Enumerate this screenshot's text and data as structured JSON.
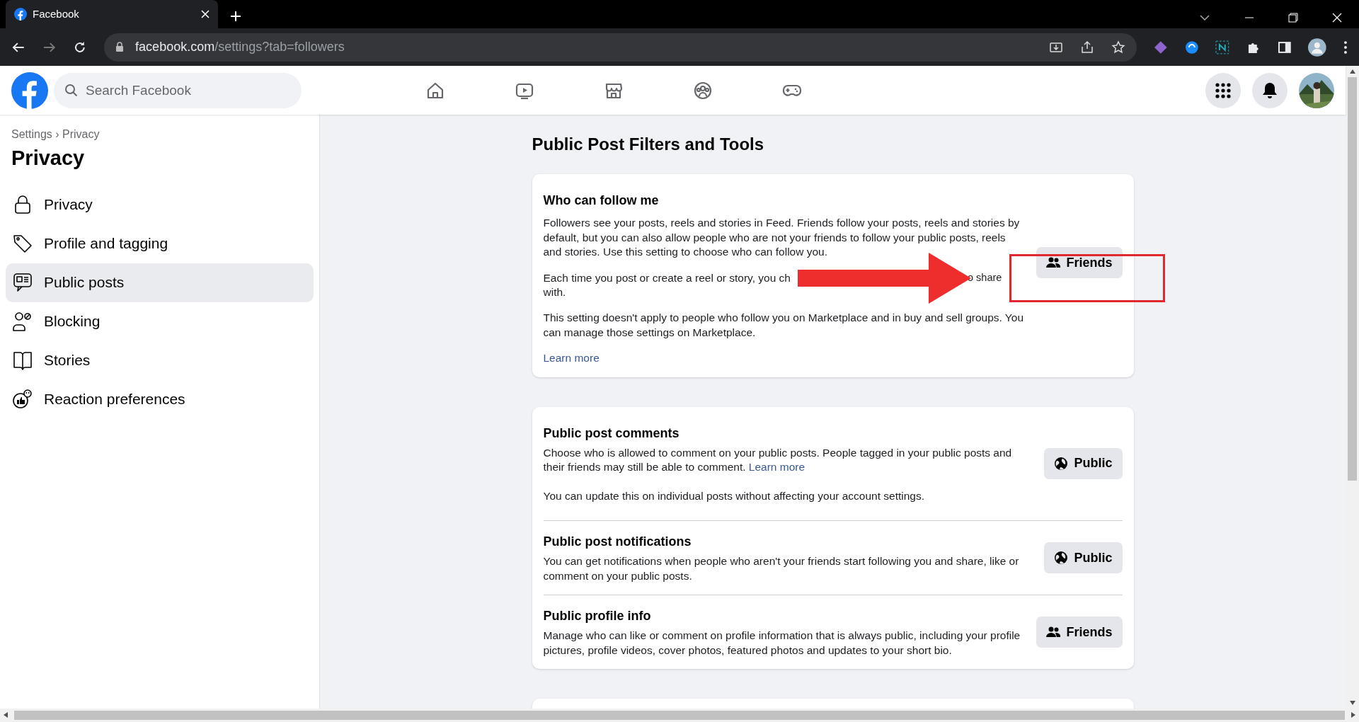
{
  "browser": {
    "tab_title": "Facebook",
    "url_host": "facebook.com",
    "url_path": "/settings?tab=followers"
  },
  "header": {
    "search": {
      "placeholder": "Search Facebook"
    },
    "nav": [
      {
        "selected": false
      },
      {
        "selected": false
      },
      {
        "selected": false
      },
      {
        "selected": false
      },
      {
        "selected": false
      }
    ]
  },
  "sidebar": {
    "breadcrumb": "Settings › Privacy",
    "title": "Privacy",
    "items": [
      {
        "label": "Privacy",
        "selected": false
      },
      {
        "label": "Profile and tagging",
        "selected": false
      },
      {
        "label": "Public posts",
        "selected": true
      },
      {
        "label": "Blocking",
        "selected": false
      },
      {
        "label": "Stories",
        "selected": false
      },
      {
        "label": "Reaction preferences",
        "selected": false
      }
    ]
  },
  "main": {
    "title": "Public Post Filters and Tools",
    "cards": [
      {
        "kind": "follow",
        "sections": [
          {
            "heading": "Who can follow me",
            "paragraphs": [
              {
                "kind": "text",
                "text": "Followers see your posts, reels and stories in Feed. Friends follow your posts, reels and stories by default, but you can also allow people who are not your friends to follow your public posts, reels and stories. Use this setting to choose who can follow you."
              },
              {
                "kind": "covered",
                "before": "Each time you post or create a reel or story, you ch",
                "after": "o share",
                "next_line": "with."
              },
              {
                "kind": "text",
                "text": "This setting doesn't apply to people who follow you on Marketplace and in buy and sell groups. You can manage those settings on Marketplace."
              },
              {
                "kind": "link",
                "text": "Learn more"
              }
            ],
            "button": {
              "kind": "friends",
              "label": "Friends"
            }
          }
        ],
        "annotations": {
          "arrow": true,
          "highlight_box": true
        }
      },
      {
        "kind": "list",
        "sections": [
          {
            "heading": "Public post comments",
            "paragraphs": [
              {
                "kind": "text",
                "text": "Choose who is allowed to comment on your public posts. People tagged in your public posts and their friends may still be able to comment.",
                "link": "Learn more"
              },
              {
                "kind": "text",
                "text": "You can update this on individual posts without affecting your account settings."
              }
            ],
            "button": {
              "kind": "public",
              "label": "Public"
            }
          },
          {
            "heading": "Public post notifications",
            "paragraphs": [
              {
                "kind": "text",
                "text": "You can get notifications when people who aren't your friends start following you and share, like or comment on your public posts."
              }
            ],
            "button": {
              "kind": "public",
              "label": "Public"
            }
          },
          {
            "heading": "Public profile info",
            "paragraphs": [
              {
                "kind": "text",
                "text": "Manage who can like or comment on profile information that is always public, including your profile pictures, profile videos, cover photos, featured photos and updates to your short bio."
              }
            ],
            "button": {
              "kind": "friends",
              "label": "Friends"
            }
          }
        ]
      },
      {
        "kind": "cut"
      }
    ]
  }
}
